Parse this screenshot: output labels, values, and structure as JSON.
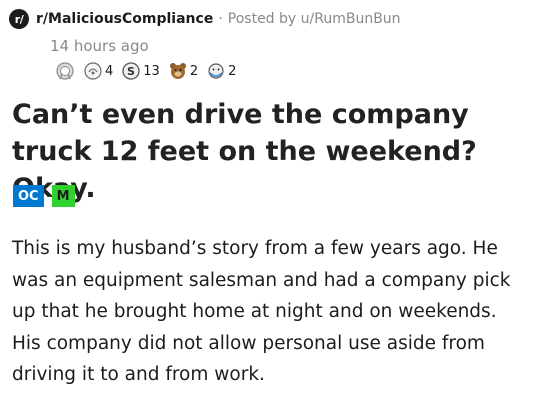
{
  "post": {
    "subreddit_icon_text": "r/",
    "subreddit": "r/MaliciousCompliance",
    "separator": "·",
    "posted_by": "Posted by u/RumBunBun",
    "time_ago": "14 hours ago",
    "awards": [
      {
        "icon": "silver-award-icon",
        "count": ""
      },
      {
        "icon": "helpful-award-icon",
        "count": "4"
      },
      {
        "icon": "wholesome-award-icon",
        "count": "13"
      },
      {
        "icon": "bear-award-icon",
        "count": "2"
      },
      {
        "icon": "hugz-award-icon",
        "count": "2"
      }
    ],
    "title": "Can’t even drive the company truck 12 feet on the weekend? Okay.",
    "flairs": {
      "oc": {
        "label": "OC",
        "color": "#0079d3"
      },
      "m": {
        "label": "M",
        "color": "#2ed12e"
      }
    },
    "body": "This is my husband’s story from a few years ago. He was an equipment salesman and had a company pick up that he brought home at night and on weekends. His company did not allow personal use aside from driving it to and from work."
  }
}
